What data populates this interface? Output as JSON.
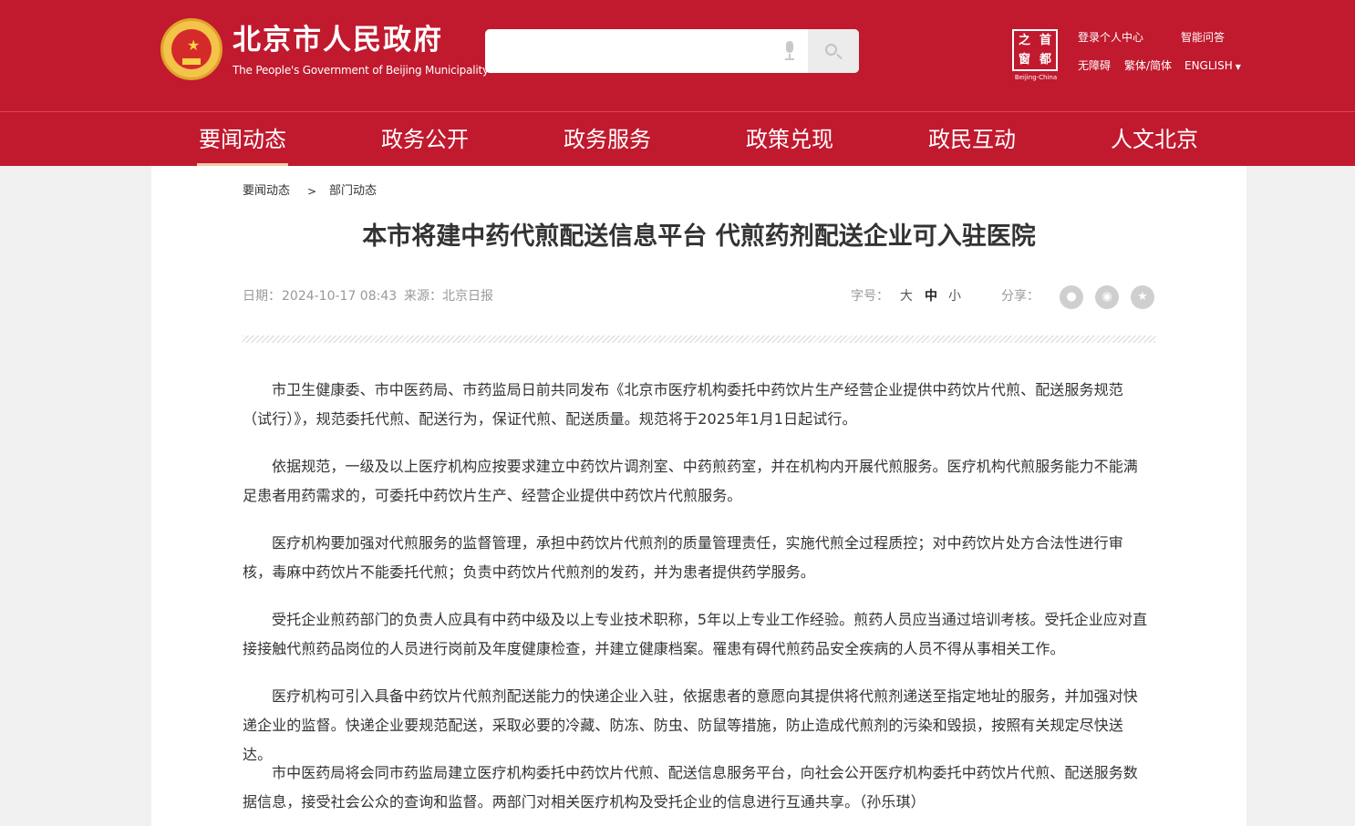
{
  "header": {
    "site_title": "北京市人民政府",
    "site_subtitle": "The People's Government of Beijing Municipality",
    "search_placeholder": "",
    "capital_logo": [
      "之",
      "首",
      "窗",
      "都"
    ],
    "capital_caption": "Beijing-China",
    "links": {
      "login": "登录个人中心",
      "ai_qa": "智能问答",
      "accessibility": "无障碍",
      "trad_simp": "繁体/简体",
      "english": "ENGLISH"
    }
  },
  "nav": {
    "items": [
      "要闻动态",
      "政务公开",
      "政务服务",
      "政策兑现",
      "政民互动",
      "人文北京"
    ],
    "active_index": 0
  },
  "article": {
    "breadcrumb": [
      "要闻动态",
      "部门动态"
    ],
    "breadcrumb_separator": ">",
    "title": "本市将建中药代煎配送信息平台 代煎药剂配送企业可入驻医院",
    "date_label": "日期：",
    "date": "2024-10-17 08:43",
    "source_label": "来源：",
    "source": "北京日报",
    "font_size_label": "字号：",
    "font_sizes": [
      "大",
      "中",
      "小"
    ],
    "font_size_selected": "中",
    "share_label": "分享：",
    "share_icons": [
      "wechat-icon",
      "weibo-icon",
      "favorite-star-icon"
    ],
    "paragraphs": [
      "市卫生健康委、市中医药局、市药监局日前共同发布《北京市医疗机构委托中药饮片生产经营企业提供中药饮片代煎、配送服务规范（试行）》，规范委托代煎、配送行为，保证代煎、配送质量。规范将于2025年1月1日起试行。",
      "依据规范，一级及以上医疗机构应按要求建立中药饮片调剂室、中药煎药室，并在机构内开展代煎服务。医疗机构代煎服务能力不能满足患者用药需求的，可委托中药饮片生产、经营企业提供中药饮片代煎服务。",
      "医疗机构要加强对代煎服务的监督管理，承担中药饮片代煎剂的质量管理责任，实施代煎全过程质控；对中药饮片处方合法性进行审核，毒麻中药饮片不能委托代煎；负责中药饮片代煎剂的发药，并为患者提供药学服务。",
      "受托企业煎药部门的负责人应具有中药中级及以上专业技术职称，5年以上专业工作经验。煎药人员应当通过培训考核。受托企业应对直接接触代煎药品岗位的人员进行岗前及年度健康检查，并建立健康档案。罹患有碍代煎药品安全疾病的人员不得从事相关工作。",
      "医疗机构可引入具备中药饮片代煎剂配送能力的快递企业入驻，依据患者的意愿向其提供将代煎剂递送至指定地址的服务，并加强对快递企业的监督。快递企业要规范配送，采取必要的冷藏、防冻、防虫、防鼠等措施，防止造成代煎剂的污染和毁损，按照有关规定尽快送达。",
      "市中医药局将会同市药监局建立医疗机构委托中药饮片代煎、配送信息服务平台，向社会公开医疗机构委托中药饮片代煎、配送服务数据信息，接受社会公众的查询和监督。两部门对相关医疗机构及受托企业的信息进行互通共享。（孙乐琪）"
    ]
  },
  "colors": {
    "brand_red": "#c1192e",
    "nav_underline": "#f1c9a8",
    "page_bg": "#f0f0f0"
  }
}
